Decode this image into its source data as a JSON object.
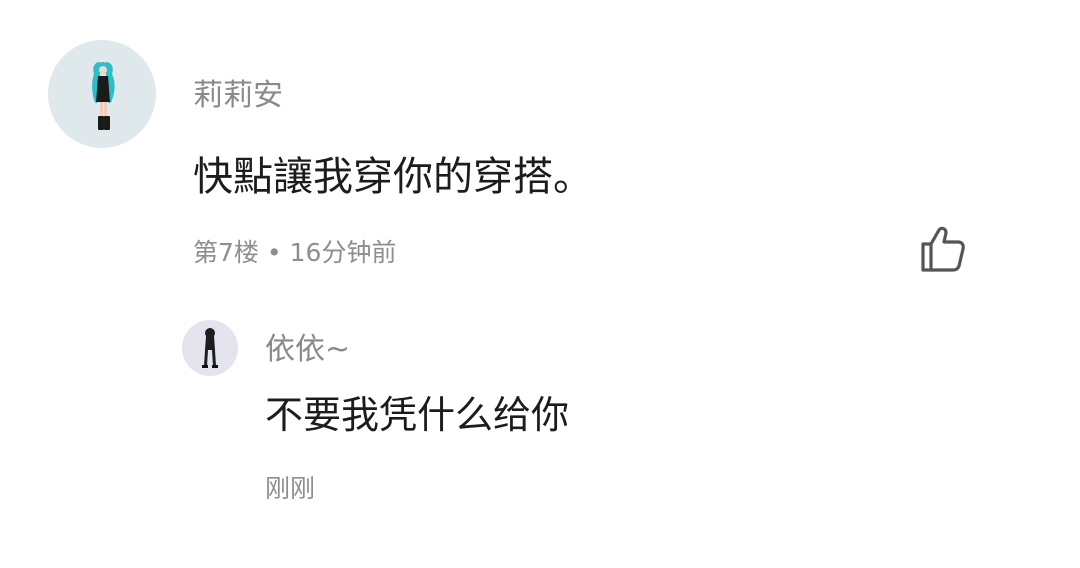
{
  "comment": {
    "username": "莉莉安",
    "text": "快點讓我穿你的穿搭。",
    "floor": "第7楼",
    "separator": "•",
    "time": "16分钟前",
    "avatar_icon": "teal-hair-character-avatar",
    "like_icon": "thumbs-up-icon"
  },
  "reply": {
    "username": "依依~",
    "text": "不要我凭什么给你",
    "time": "刚刚",
    "avatar_icon": "dark-outfit-character-avatar"
  },
  "colors": {
    "username": "#8a8a8a",
    "text": "#1c1c1c",
    "meta": "#8e8e8e",
    "avatar_main_bg": "#dfe9ec",
    "avatar_reply_bg": "#e3e4ee"
  }
}
